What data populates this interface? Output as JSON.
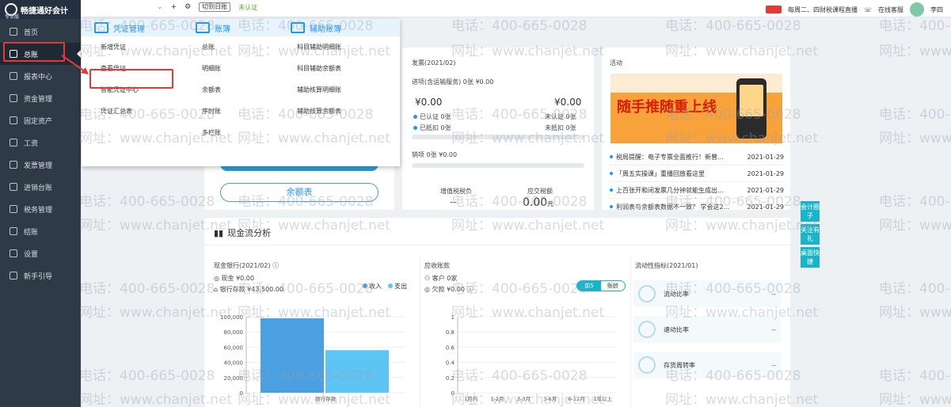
{
  "app": {
    "name": "畅捷通好会计",
    "sub": "专业版"
  },
  "sidebar": {
    "items": [
      {
        "label": "首页",
        "icon": "home-icon"
      },
      {
        "label": "总账",
        "icon": "ledger-icon"
      },
      {
        "label": "报表中心",
        "icon": "report-icon"
      },
      {
        "label": "资金管理",
        "icon": "fund-icon"
      },
      {
        "label": "固定资产",
        "icon": "asset-icon"
      },
      {
        "label": "工资",
        "icon": "salary-icon"
      },
      {
        "label": "发票管理",
        "icon": "invoice-icon"
      },
      {
        "label": "进销台账",
        "icon": "stock-icon"
      },
      {
        "label": "税务管理",
        "icon": "tax-icon"
      },
      {
        "label": "结账",
        "icon": "close-books-icon"
      },
      {
        "label": "设置",
        "icon": "settings-icon"
      },
      {
        "label": "新手引导",
        "icon": "guide-icon"
      }
    ]
  },
  "topbar": {
    "switch_label": "切到日账",
    "cert": "未认证",
    "live": "每周二、四财税课程直播",
    "service": "在线客服",
    "user": "李四"
  },
  "mega_menu": {
    "col1": {
      "title": "凭证管理",
      "items": [
        "新增凭证",
        "查看凭证",
        "智能凭证中心",
        "凭证汇总表"
      ]
    },
    "col2": {
      "title": "账簿",
      "items": [
        "总账",
        "明细账",
        "余额表",
        "序时账",
        "多栏账"
      ]
    },
    "col3": {
      "title": "辅助账簿",
      "items": [
        "科目辅助明细账",
        "科目辅助余额表",
        "辅助核算明细账",
        "辅助核算余额表"
      ]
    }
  },
  "quick": {
    "balance_btn": "余额表"
  },
  "invoice": {
    "title": "发票(2021/02)",
    "sales": "进项(含运输服务)",
    "sales_count": "0张",
    "sales_amt": "¥0.00",
    "left_amt": "¥0.00",
    "right_amt": "¥0.00",
    "certified": "已认证",
    "certified_n": "0张",
    "uncertified": "未认证",
    "uncertified_n": "0张",
    "checked": "已抵扣",
    "checked_n": "0张",
    "unchecked": "未抵扣",
    "unchecked_n": "0张",
    "out": "销项",
    "out_n": "0张",
    "out_amt": "¥0.00",
    "vat_label": "增值税税负",
    "vat_val": "--",
    "tax_label": "应交税额",
    "tax_val": "0.00",
    "tax_unit": "元"
  },
  "activity": {
    "title": "活动",
    "banner_text": "随手推随重上线",
    "news": [
      {
        "t": "税局提醒：电子专票全面推行！新曾...",
        "d": "2021-01-29"
      },
      {
        "t": "「周五实操课」重播回放看这里",
        "d": "2021-01-29"
      },
      {
        "t": "上百张开和闭发票几分钟就能生成出...",
        "d": "2021-01-29"
      },
      {
        "t": "利润表与余额表数据不一致？ 学会这2...",
        "d": "2021-01-29"
      }
    ]
  },
  "side_tabs": [
    "会计圈子",
    "关注有礼",
    "桌面快捷"
  ],
  "cashflow": {
    "title": "现金流分析",
    "bank_title": "现金银行(2021/02)",
    "cash": "现金",
    "cash_val": "¥0.00",
    "bank": "银行存款",
    "bank_val": "¥43,500.00",
    "legend_in": "收入",
    "legend_out": "支出",
    "recv_title": "应收账款",
    "customer": "客户",
    "customer_n": "0家",
    "owed": "欠款",
    "owed_val": "¥0.00",
    "toggle_a": "前5",
    "toggle_b": "账龄",
    "liq_title": "流动性指标(2021/01)",
    "kpis": [
      {
        "label": "流动比率",
        "val": "--"
      },
      {
        "label": "速动比率",
        "val": "--"
      },
      {
        "label": "存货周转率",
        "val": "--"
      }
    ]
  },
  "chart_data": [
    {
      "type": "bar",
      "categories": [
        "银行存款"
      ],
      "series": [
        {
          "name": "收入",
          "values": [
            98000
          ]
        },
        {
          "name": "支出",
          "values": [
            56000
          ]
        }
      ],
      "y_ticks": [
        "100,000",
        "80,000",
        "60,000",
        "40,000",
        "20,000",
        "0"
      ],
      "ylim": [
        0,
        100000
      ],
      "colors": [
        "#4aa0e0",
        "#5ec4f3"
      ]
    },
    {
      "type": "bar",
      "categories": [
        "1月内",
        "1-2月",
        "2-3月",
        "3-6月",
        "6-12月",
        "1年以上"
      ],
      "values": [
        0,
        0,
        0,
        0,
        0,
        0
      ],
      "y_ticks": [
        "1",
        "0.8",
        "0.6",
        "0.4",
        "0.2",
        "0"
      ],
      "ylim": [
        0,
        1
      ]
    }
  ],
  "watermark": {
    "phone": "电话：400-665-0028",
    "url": "网址：www.chanjet.net"
  }
}
